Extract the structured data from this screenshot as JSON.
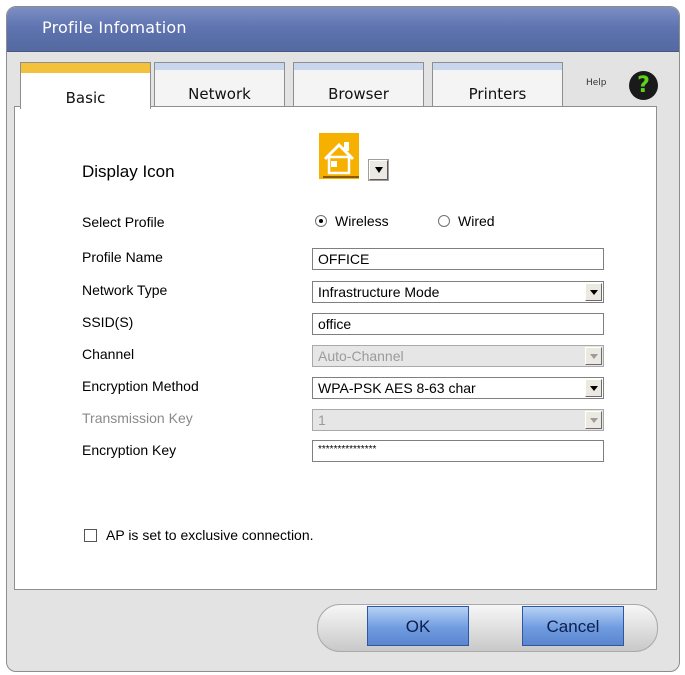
{
  "window": {
    "title": "Profile Infomation"
  },
  "tabs": [
    {
      "label": "Basic",
      "active": true
    },
    {
      "label": "Network",
      "active": false
    },
    {
      "label": "Browser",
      "active": false
    },
    {
      "label": "Printers",
      "active": false
    }
  ],
  "help": {
    "label": "Help",
    "icon": "question-mark-icon",
    "glyph": "?"
  },
  "display_icon": {
    "label": "Display Icon",
    "icon": "house-icon"
  },
  "select_profile": {
    "label": "Select Profile",
    "options": [
      "Wireless",
      "Wired"
    ],
    "selected": "Wireless"
  },
  "fields": {
    "profile_name": {
      "label": "Profile Name",
      "value": "OFFICE"
    },
    "network_type": {
      "label": "Network Type",
      "value": "Infrastructure Mode"
    },
    "ssid": {
      "label": "SSID(S)",
      "value": "office"
    },
    "channel": {
      "label": "Channel",
      "value": "Auto-Channel",
      "enabled": false
    },
    "encryption_method": {
      "label": "Encryption Method",
      "value": "WPA-PSK AES 8-63 char"
    },
    "transmission_key": {
      "label": "Transmission Key",
      "value": "1",
      "enabled": false
    },
    "encryption_key": {
      "label": "Encryption Key",
      "value": "***************"
    }
  },
  "exclusive": {
    "label": "AP is set to exclusive connection.",
    "checked": false
  },
  "buttons": {
    "ok": "OK",
    "cancel": "Cancel"
  },
  "colors": {
    "title_bar": "#5f74b1",
    "active_tab": "#f3c23a",
    "button": "#6f9be0",
    "help": "#5dd21d"
  }
}
